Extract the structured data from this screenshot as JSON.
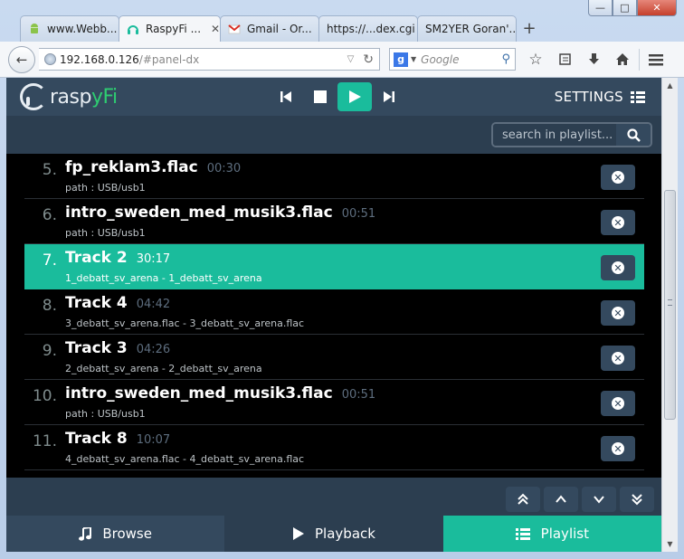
{
  "browser": {
    "tabs": [
      {
        "label": "www.Webb...",
        "active": false,
        "icon": "android-icon"
      },
      {
        "label": "RaspyFi ...",
        "active": true,
        "icon": "headphones-icon"
      },
      {
        "label": "Gmail - Or...",
        "active": false,
        "icon": "gmail-icon"
      },
      {
        "label": "https://...dex.cgi",
        "active": false,
        "icon": ""
      },
      {
        "label": "SM2YER Goran'...",
        "active": false,
        "icon": ""
      }
    ],
    "url_host": "192.168.0.126",
    "url_path": "/#panel-dx",
    "search_placeholder": "Google",
    "search_engine_letter": "g"
  },
  "app": {
    "logo_r": "r",
    "logo_asp": "asp",
    "logo_y": "y",
    "logo_fi": "Fi",
    "settings_label": "SETTINGS",
    "playlist_search_placeholder": "search in playlist...",
    "accent_color": "#1abc9c",
    "playlist": [
      {
        "num": "5.",
        "title": "fp_reklam3.flac",
        "duration": "00:30",
        "sub": "path : USB/usb1",
        "active": false
      },
      {
        "num": "6.",
        "title": "intro_sweden_med_musik3.flac",
        "duration": "00:51",
        "sub": "path : USB/usb1",
        "active": false
      },
      {
        "num": "7.",
        "title": "Track 2",
        "duration": "30:17",
        "sub": "1_debatt_sv_arena - 1_debatt_sv_arena",
        "active": true
      },
      {
        "num": "8.",
        "title": "Track 4",
        "duration": "04:42",
        "sub": "3_debatt_sv_arena.flac - 3_debatt_sv_arena.flac",
        "active": false
      },
      {
        "num": "9.",
        "title": "Track 3",
        "duration": "04:26",
        "sub": "2_debatt_sv_arena - 2_debatt_sv_arena",
        "active": false
      },
      {
        "num": "10.",
        "title": "intro_sweden_med_musik3.flac",
        "duration": "00:51",
        "sub": "path : USB/usb1",
        "active": false
      },
      {
        "num": "11.",
        "title": "Track 8",
        "duration": "10:07",
        "sub": "4_debatt_sv_arena.flac - 4_debatt_sv_arena.flac",
        "active": false
      }
    ],
    "footer": {
      "browse": "Browse",
      "playback": "Playback",
      "playlist": "Playlist"
    }
  }
}
